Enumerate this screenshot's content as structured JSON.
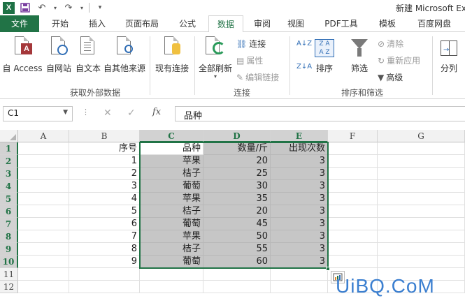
{
  "window": {
    "title": "新建 Microsoft Ex"
  },
  "tabs": [
    "文件",
    "开始",
    "插入",
    "页面布局",
    "公式",
    "数据",
    "审阅",
    "视图",
    "PDF工具",
    "模板",
    "百度网盘"
  ],
  "active_tab": "数据",
  "ribbon": {
    "get_external": {
      "label": "获取外部数据",
      "buttons": [
        "自 Access",
        "自网站",
        "自文本",
        "自其他来源"
      ]
    },
    "existing_connections": "现有连接",
    "refresh_all": "全部刷新",
    "connections": {
      "label": "连接",
      "connections": "连接",
      "properties": "属性",
      "edit_links": "编辑链接"
    },
    "sort_filter": {
      "label": "排序和筛选",
      "sort": "排序",
      "filter": "筛选",
      "clear": "清除",
      "reapply": "重新应用",
      "advanced": "高级"
    },
    "split": "分列"
  },
  "formula_bar": {
    "name_box": "C1",
    "fx": "fx",
    "content": "品种"
  },
  "columns": [
    "A",
    "B",
    "C",
    "D",
    "E",
    "F",
    "G"
  ],
  "rows": [
    "1",
    "2",
    "3",
    "4",
    "5",
    "6",
    "7",
    "8",
    "9",
    "10",
    "11",
    "12"
  ],
  "headers": {
    "b": "序号",
    "c": "品种",
    "d": "数量/斤",
    "e": "出现次数"
  },
  "table": [
    {
      "b": "1",
      "c": "苹果",
      "d": "20",
      "e": "3"
    },
    {
      "b": "2",
      "c": "桔子",
      "d": "25",
      "e": "3"
    },
    {
      "b": "3",
      "c": "葡萄",
      "d": "30",
      "e": "3"
    },
    {
      "b": "4",
      "c": "苹果",
      "d": "35",
      "e": "3"
    },
    {
      "b": "5",
      "c": "桔子",
      "d": "20",
      "e": "3"
    },
    {
      "b": "6",
      "c": "葡萄",
      "d": "45",
      "e": "3"
    },
    {
      "b": "7",
      "c": "苹果",
      "d": "50",
      "e": "3"
    },
    {
      "b": "8",
      "c": "桔子",
      "d": "55",
      "e": "3"
    },
    {
      "b": "9",
      "c": "葡萄",
      "d": "60",
      "e": "3"
    }
  ],
  "watermark": "UiBQ.CoM",
  "colors": {
    "excel_green": "#217346",
    "selection_fill": "#c6c6c6",
    "watermark": "#3b7fd0"
  }
}
